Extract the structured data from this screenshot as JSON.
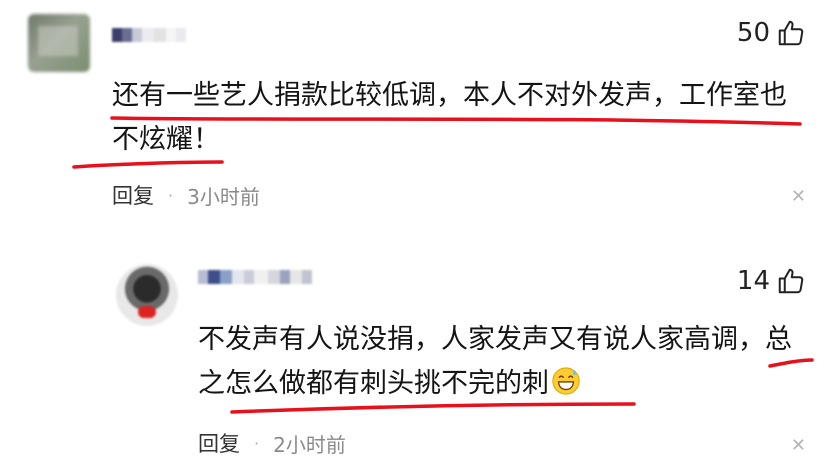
{
  "comments": [
    {
      "likes": "50",
      "text": "还有一些艺人捐款比较低调，本人不对外发声，工作室也不炫耀！",
      "reply_label": "回复",
      "separator": "·",
      "time": "3小时前"
    },
    {
      "likes": "14",
      "text": "不发声有人说没捐，人家发声又有说人家高调，总之怎么做都有刺头挑不完的刺",
      "reply_label": "回复",
      "separator": "·",
      "time": "2小时前"
    }
  ],
  "icons": {
    "like": "thumbs-up-icon",
    "close": "close-icon",
    "emoji": "grinning-sweat-emoji"
  },
  "colors": {
    "underline": "#e8101c",
    "meta_text": "#8a8a8a"
  }
}
